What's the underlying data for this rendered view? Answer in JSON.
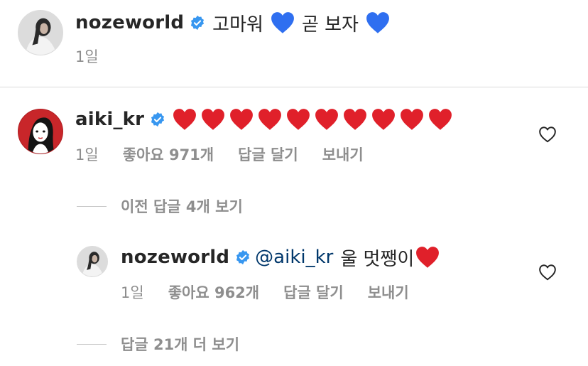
{
  "comments": [
    {
      "username": "nozeworld",
      "text_before": "고마워",
      "text_mid": "곧 보자",
      "time": "1일"
    },
    {
      "username": "aiki_kr",
      "time": "1일",
      "likes": "좋아요 971개",
      "reply": "답글 달기",
      "send": "보내기"
    },
    {
      "username": "nozeworld",
      "mention": "@aiki_kr",
      "text": "울 멋쨍이",
      "time": "1일",
      "likes": "좋아요 962개",
      "reply": "답글 달기",
      "send": "보내기"
    }
  ],
  "threads": {
    "previous_replies": "이전 답글 4개 보기",
    "more_replies": "답글 21개 더 보기"
  },
  "icons": {
    "verified": "verified-badge-icon",
    "like": "heart-outline-icon",
    "blue_heart": "blue-heart-emoji",
    "red_heart": "red-heart-emoji"
  },
  "colors": {
    "verified": "#3897f0",
    "red_heart": "#e0202a",
    "blue_heart": "#2f6ff0",
    "mention": "#00376b",
    "meta": "#8e8e8e"
  }
}
